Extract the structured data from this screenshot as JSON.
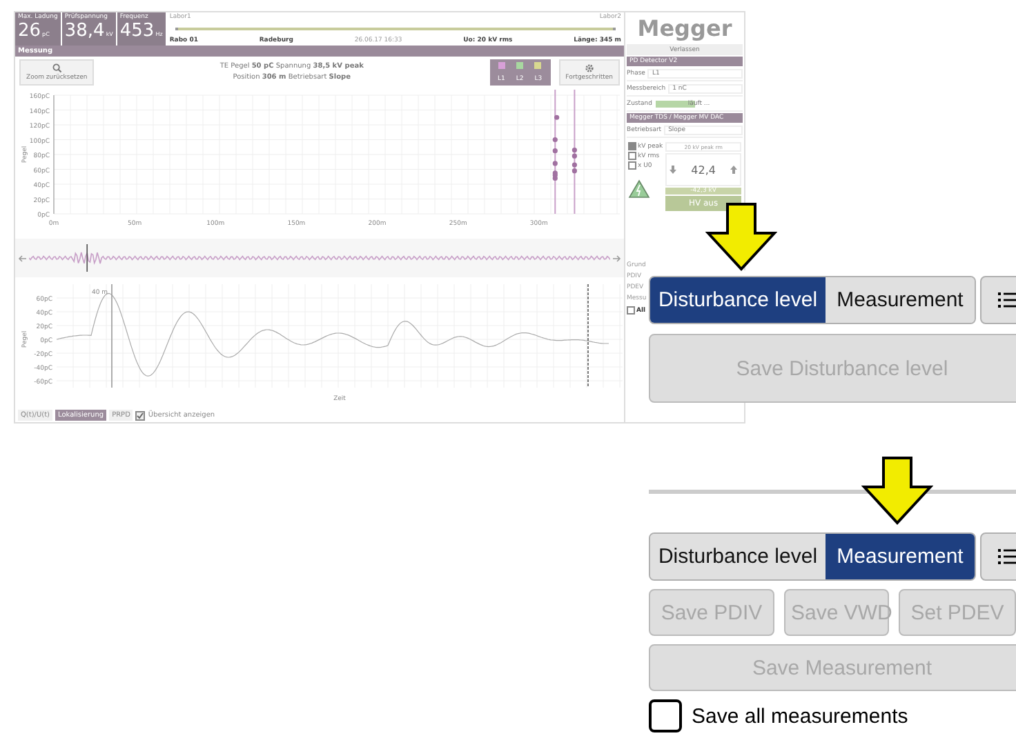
{
  "app": {
    "metrics": [
      {
        "label": "Max. Ladung",
        "value": "26",
        "unit": "pC"
      },
      {
        "label": "Prüfspannung",
        "value": "38,4",
        "unit": "kV"
      },
      {
        "label": "Frequenz",
        "value": "453",
        "unit": "Hz"
      }
    ],
    "cable": {
      "start": "Labor1",
      "end": "Labor2",
      "name": "Rabo 01",
      "place": "Radeburg",
      "date": "26.06.17 16:33",
      "voltage": "Uo: 20 kV rms",
      "length": "Länge: 345 m"
    },
    "section_title": "Messung",
    "zoom_button": "Zoom zurücksetzen",
    "info_lines": [
      "TE Pegel **50 pC** Spannung **38,5 kV peak**",
      "Position **306 m** Betriebsart **Slope**"
    ],
    "phases": [
      {
        "label": "L1",
        "color": "#d8a0d8"
      },
      {
        "label": "L2",
        "color": "#a8d8a0"
      },
      {
        "label": "L3",
        "color": "#d8d890"
      }
    ],
    "advanced_button": "Fortgeschritten",
    "location_chart": {
      "chart_data": {
        "type": "scatter",
        "ylabel": "Pegel",
        "xlim": [
          0,
          350
        ],
        "ylim": [
          0,
          160
        ],
        "xticks": [
          {
            "value": 0,
            "label": "0m"
          },
          {
            "value": 50,
            "label": "50m"
          },
          {
            "value": 100,
            "label": "100m"
          },
          {
            "value": 150,
            "label": "150m"
          },
          {
            "value": 200,
            "label": "200m"
          },
          {
            "value": 250,
            "label": "250m"
          },
          {
            "value": 300,
            "label": "300m"
          }
        ],
        "yticks": [
          {
            "value": 0,
            "label": "0pC"
          },
          {
            "value": 20,
            "label": "20pC"
          },
          {
            "value": 40,
            "label": "40pC"
          },
          {
            "value": 60,
            "label": "60pC"
          },
          {
            "value": 80,
            "label": "80pC"
          },
          {
            "value": 100,
            "label": "100pC"
          },
          {
            "value": 120,
            "label": "120pC"
          },
          {
            "value": 140,
            "label": "140pC"
          },
          {
            "value": 160,
            "label": "160pC"
          }
        ],
        "x": [
          310,
          310,
          310,
          310,
          310,
          310,
          311,
          322,
          322,
          322,
          322
        ],
        "grid": true,
        "ref_lines": [
          {
            "axis": "x",
            "value": 310,
            "color": "#c9a0c9"
          },
          {
            "axis": "x",
            "value": 322,
            "color": "#c9a0c9"
          }
        ],
        "series": [
          {
            "color": "#a070a0",
            "values": [
              48,
              52,
              55,
              68,
              85,
              100,
              130,
              58,
              66,
              78,
              86
            ]
          }
        ]
      }
    },
    "waveform": {
      "ylabel": "Pegel",
      "yticks": [
        "60pC",
        "40pC",
        "20pC",
        "0pC",
        "-20pC",
        "-40pC",
        "-60pC"
      ],
      "xlabel": "Zeit",
      "marker": "40 m"
    },
    "view_tabs": [
      {
        "label": "Q(t)/U(t)",
        "selected": false
      },
      {
        "label": "Lokalisierung",
        "selected": true
      },
      {
        "label": "PRPD",
        "selected": false
      }
    ],
    "overview_checkbox": {
      "label": "Übersicht anzeigen",
      "checked": true
    }
  },
  "side_panel": {
    "logo": "Megger",
    "exit_button": "Verlassen",
    "detector_title": "PD Detector V2",
    "phase_label": "Phase",
    "phase_value": "L1",
    "range_label": "Messbereich",
    "range_value": "1 nC",
    "state_label": "Zustand",
    "state_value": "läuft ...",
    "source_title": "Megger TDS / Megger MV DAC",
    "mode_label": "Betriebsart",
    "mode_value": "Slope",
    "units": [
      {
        "label": "kV peak",
        "checked": true
      },
      {
        "label": "kV rms",
        "checked": false
      },
      {
        "label": "x U0",
        "checked": false
      }
    ],
    "setpoint": "20 kV peak rm",
    "value": "42,4",
    "reading": "-42,3 kV",
    "hv_button": "HV aus",
    "hidden_labels": [
      "Grund",
      "PDIV",
      "PDEV",
      "Messu"
    ],
    "all_checkbox": {
      "label": "All",
      "checked": false
    }
  },
  "zoom_panels": [
    {
      "divider": false,
      "tabs": [
        {
          "label": "Disturbance level",
          "selected": true
        },
        {
          "label": "Measurement",
          "selected": false
        }
      ],
      "button_rows": [
        [
          {
            "label": "Save Disturbance level",
            "disabled": true
          }
        ]
      ]
    },
    {
      "divider": true,
      "tabs": [
        {
          "label": "Disturbance level",
          "selected": false
        },
        {
          "label": "Measurement",
          "selected": true
        }
      ],
      "button_rows": [
        [
          {
            "label": "Save PDIV",
            "disabled": true
          },
          {
            "label": "Save VWD",
            "disabled": true
          },
          {
            "label": "Set PDEV",
            "disabled": true
          }
        ],
        [
          {
            "label": "Save Measurement",
            "disabled": true
          }
        ]
      ],
      "checkbox": {
        "label": "Save all measurements",
        "checked": false
      }
    }
  ]
}
